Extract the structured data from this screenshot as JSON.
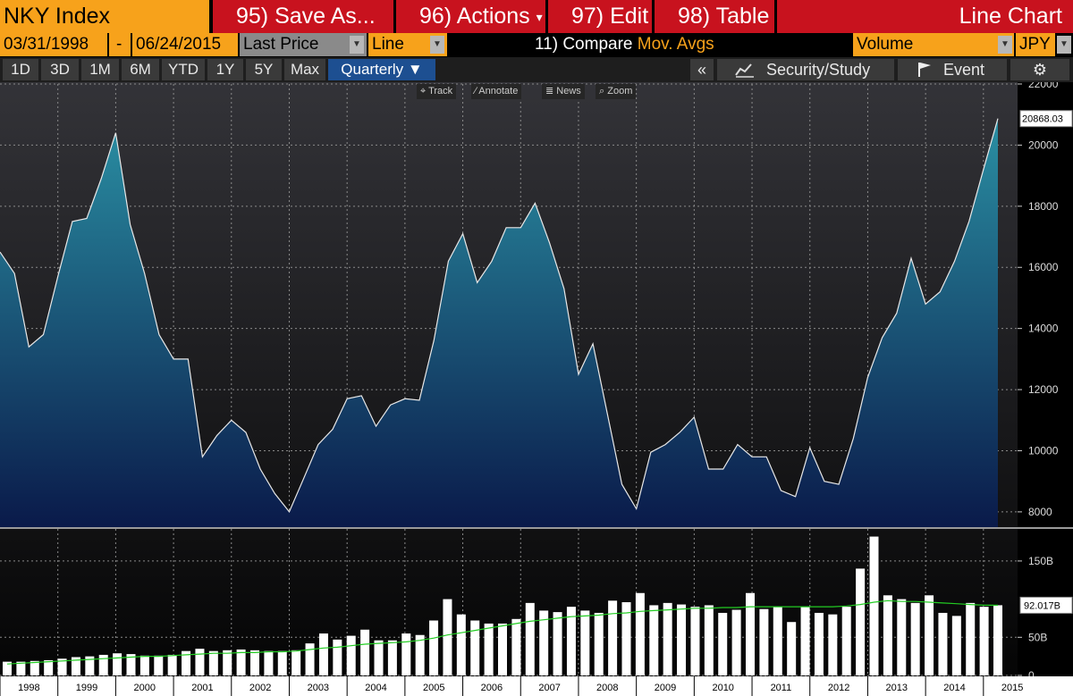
{
  "header": {
    "ticker": "NKY Index",
    "buttons": [
      {
        "label": "95) Save As...",
        "caret": false
      },
      {
        "label": "96) Actions",
        "caret": true
      },
      {
        "label": "97) Edit",
        "caret": true
      },
      {
        "label": "98) Table",
        "caret": false
      }
    ],
    "chart_type_label": "Line Chart"
  },
  "controls": {
    "start_date": "03/31/1998",
    "dash": "-",
    "end_date": "06/24/2015",
    "field": "Last Price",
    "style": "Line",
    "compare_prefix": "11) Compare",
    "compare_value": "Mov. Avgs",
    "lower_field": "Volume",
    "currency": "JPY",
    "dropdown_glyph": "▼"
  },
  "periods": {
    "items": [
      "1D",
      "3D",
      "1M",
      "6M",
      "YTD",
      "1Y",
      "5Y",
      "Max"
    ],
    "selected": "Quarterly ▼"
  },
  "toolbar": {
    "collapse": "«",
    "security_study": "Security/Study",
    "event": "Event",
    "gear": "⚙"
  },
  "chart_tools": {
    "track": "Track",
    "annotate": "Annotate",
    "news": "News",
    "zoom": "Zoom"
  },
  "colors": {
    "line": "#e8e8e8",
    "fill_top": "#2a8fa3",
    "fill_bottom": "#0a1a4a",
    "ma": "#22cc22",
    "header_orange": "#f7a21b",
    "header_red": "#c8121e",
    "selected_blue": "#1d4f91"
  },
  "chart_data": [
    {
      "type": "area",
      "series_field": "Last Price",
      "ylim": [
        7500,
        22000
      ],
      "y_ticks": [
        8000,
        10000,
        12000,
        14000,
        16000,
        18000,
        20000,
        22000
      ],
      "last_value_label": "20868.03",
      "grid": true,
      "x_start": 1998.0,
      "x_step": 0.25,
      "values": [
        16500,
        15800,
        13400,
        13800,
        15700,
        17500,
        17600,
        18900,
        20400,
        17400,
        15800,
        13800,
        13000,
        13000,
        9800,
        10500,
        11000,
        10600,
        9400,
        8600,
        8000,
        9100,
        10200,
        10700,
        11700,
        11800,
        10800,
        11500,
        11700,
        11650,
        13600,
        16200,
        17100,
        15500,
        16200,
        17300,
        17300,
        18100,
        16800,
        15300,
        12500,
        13500,
        11200,
        8900,
        8100,
        9950,
        10200,
        10600,
        11100,
        9400,
        9400,
        10200,
        9800,
        9800,
        8700,
        8500,
        10100,
        9000,
        8900,
        10400,
        12400,
        13700,
        14500,
        16300,
        14800,
        15200,
        16200,
        17500,
        19200,
        20868
      ]
    },
    {
      "type": "bar",
      "series_field": "Volume",
      "y_ticks_labels": [
        "0",
        "50B",
        "150B"
      ],
      "y_tick_values": [
        0,
        50,
        150
      ],
      "ylim": [
        0,
        185
      ],
      "last_value_label": "92.017B",
      "x_start": 1998.0,
      "x_step": 0.25,
      "values": [
        18,
        18,
        19,
        20,
        22,
        24,
        25,
        27,
        29,
        28,
        26,
        26,
        27,
        32,
        35,
        32,
        33,
        34,
        33,
        32,
        32,
        33,
        42,
        55,
        47,
        52,
        60,
        46,
        46,
        55,
        53,
        72,
        100,
        80,
        72,
        68,
        68,
        74,
        95,
        85,
        83,
        90,
        85,
        82,
        98,
        96,
        108,
        92,
        95,
        93,
        90,
        92,
        82,
        86,
        108,
        87,
        90,
        70,
        90,
        82,
        80,
        90,
        140,
        182,
        105,
        100,
        95,
        105,
        82,
        78,
        95,
        90,
        92
      ]
    },
    {
      "type": "line",
      "series_field": "Mov. Avgs",
      "values": [
        15,
        16,
        17,
        18,
        19,
        20,
        21,
        22,
        23,
        24,
        25,
        25,
        26,
        27,
        28,
        29,
        29,
        30,
        30,
        31,
        31,
        32,
        34,
        36,
        37,
        39,
        41,
        42,
        43,
        44,
        46,
        49,
        53,
        56,
        59,
        62,
        65,
        68,
        71,
        73,
        75,
        77,
        78,
        79,
        81,
        82,
        84,
        85,
        86,
        87,
        88,
        88,
        89,
        89,
        90,
        90,
        90,
        90,
        90,
        90,
        90,
        91,
        93,
        96,
        98,
        97,
        97,
        96,
        95,
        94,
        93,
        92,
        92
      ]
    }
  ],
  "x_axis_years": [
    "1998",
    "1999",
    "2000",
    "2001",
    "2002",
    "2003",
    "2004",
    "2005",
    "2006",
    "2007",
    "2008",
    "2009",
    "2010",
    "2011",
    "2012",
    "2013",
    "2014",
    "2015"
  ]
}
